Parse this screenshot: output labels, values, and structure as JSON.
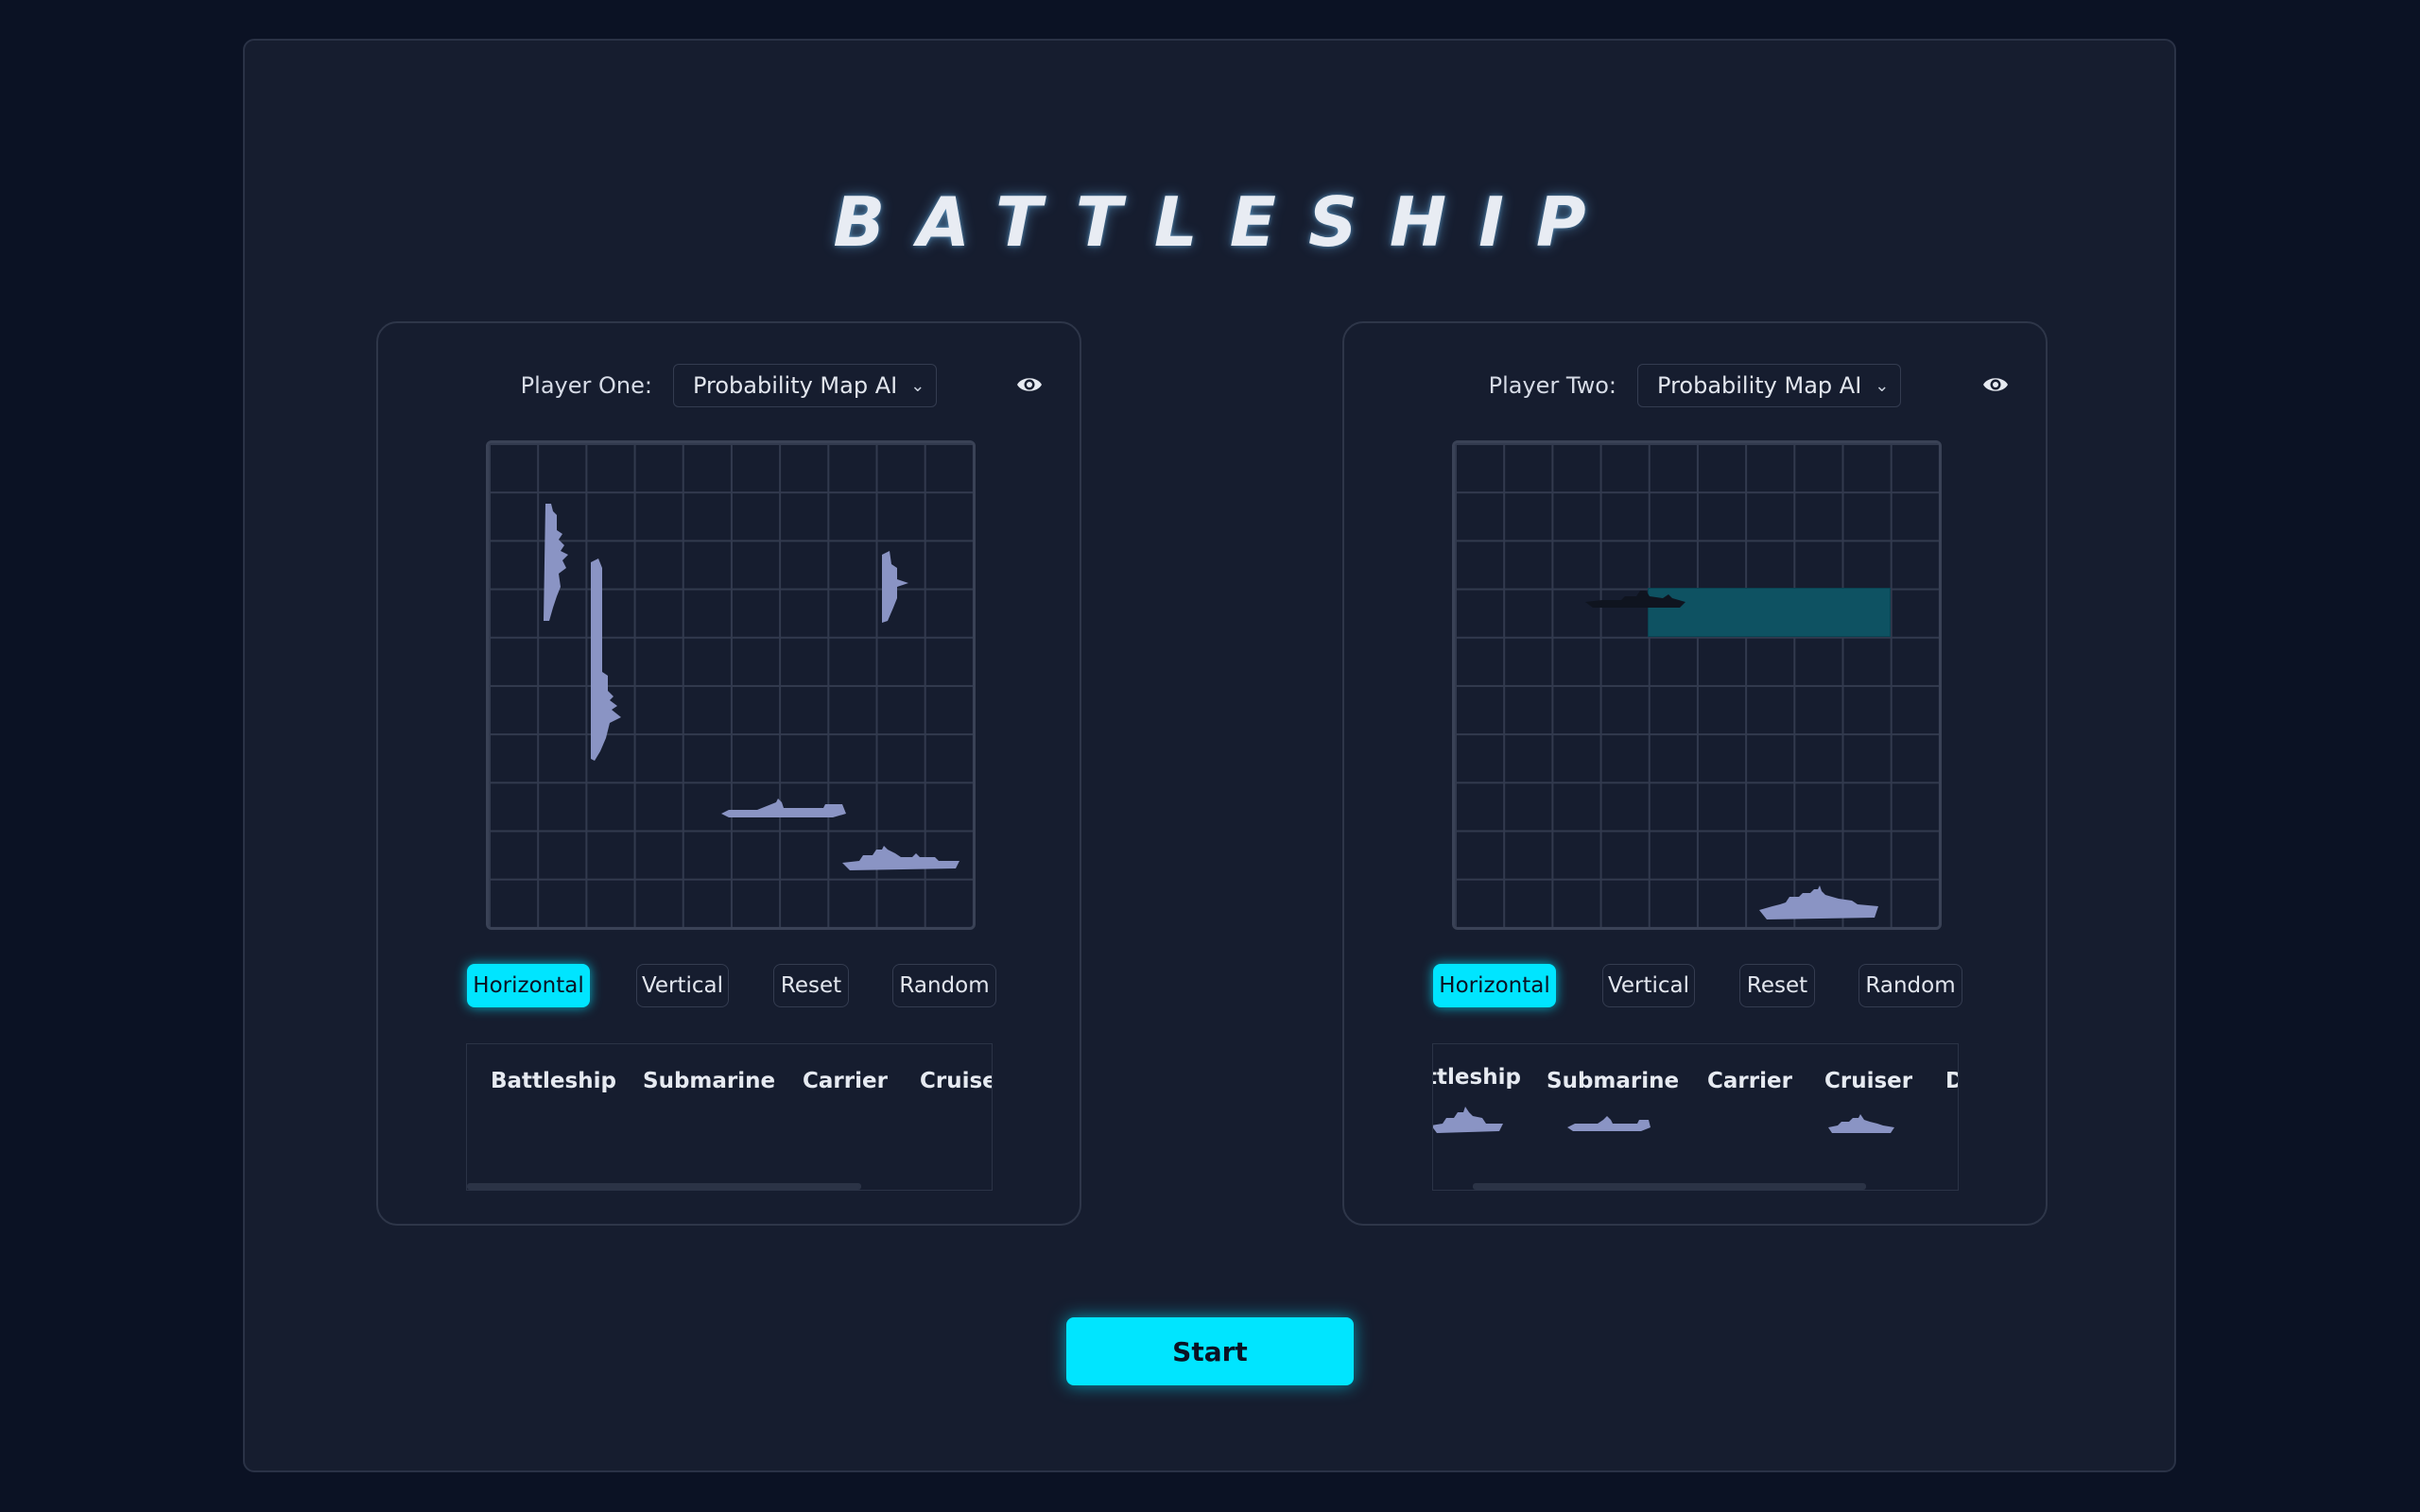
{
  "title": "BATTLESHIP",
  "start_label": "Start",
  "players": [
    {
      "label": "Player One:",
      "controller": "Probability Map AI",
      "buttons": [
        "Horizontal",
        "Vertical",
        "Reset",
        "Random"
      ],
      "active_orientation": "Horizontal",
      "tray_ships": [
        "Battleship",
        "Submarine",
        "Carrier",
        "Cruiser"
      ]
    },
    {
      "label": "Player Two:",
      "controller": "Probability Map AI",
      "buttons": [
        "Horizontal",
        "Vertical",
        "Reset",
        "Random"
      ],
      "active_orientation": "Horizontal",
      "tray_ships": [
        "Battleship",
        "Submarine",
        "Carrier",
        "Cruiser",
        "Destroyer"
      ]
    }
  ],
  "icons": {
    "visibility": "eye-icon",
    "dropdown": "chevron-down-icon"
  },
  "colors": {
    "accent": "#00e5ff",
    "background": "#0b1224",
    "panel": "#161d2f",
    "ship": "#8a94c4",
    "placement_preview": "#0e5262"
  }
}
